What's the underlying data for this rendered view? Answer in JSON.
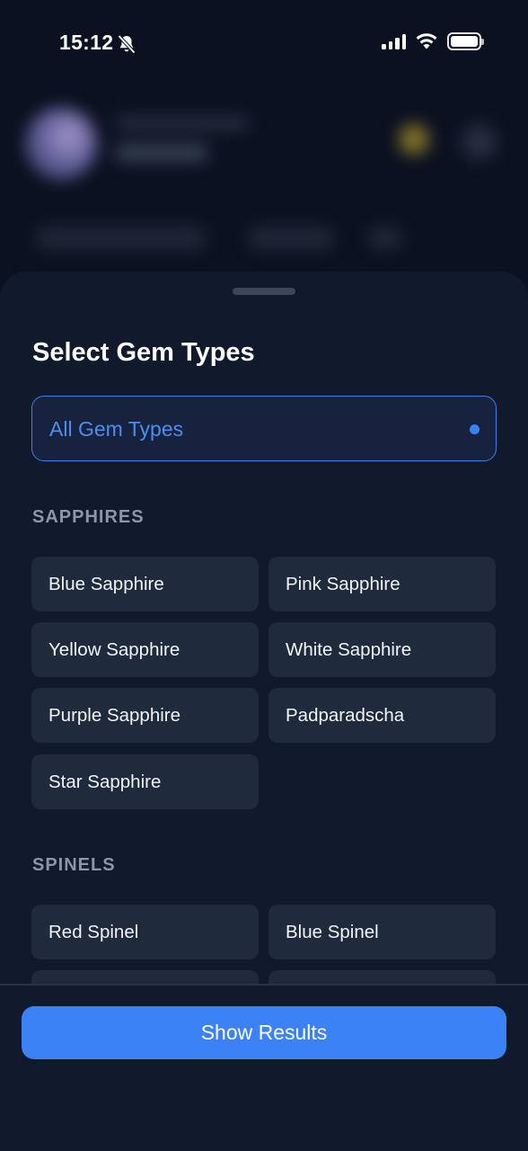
{
  "status_bar": {
    "time": "15:12"
  },
  "sheet": {
    "title": "Select Gem Types",
    "all_option": {
      "label": "All Gem Types",
      "selected": true
    },
    "sections": [
      {
        "title": "SAPPHIRES",
        "items": [
          "Blue Sapphire",
          "Pink Sapphire",
          "Yellow Sapphire",
          "White Sapphire",
          "Purple Sapphire",
          "Padparadscha",
          "Star Sapphire"
        ]
      },
      {
        "title": "SPINELS",
        "items": [
          "Red Spinel",
          "Blue Spinel"
        ]
      }
    ],
    "show_results_label": "Show Results"
  },
  "colors": {
    "accent": "#3b82f6",
    "sheet_bg": "#111a2c",
    "chip_bg": "#1f2a3d",
    "section_title": "#8d96a8"
  }
}
